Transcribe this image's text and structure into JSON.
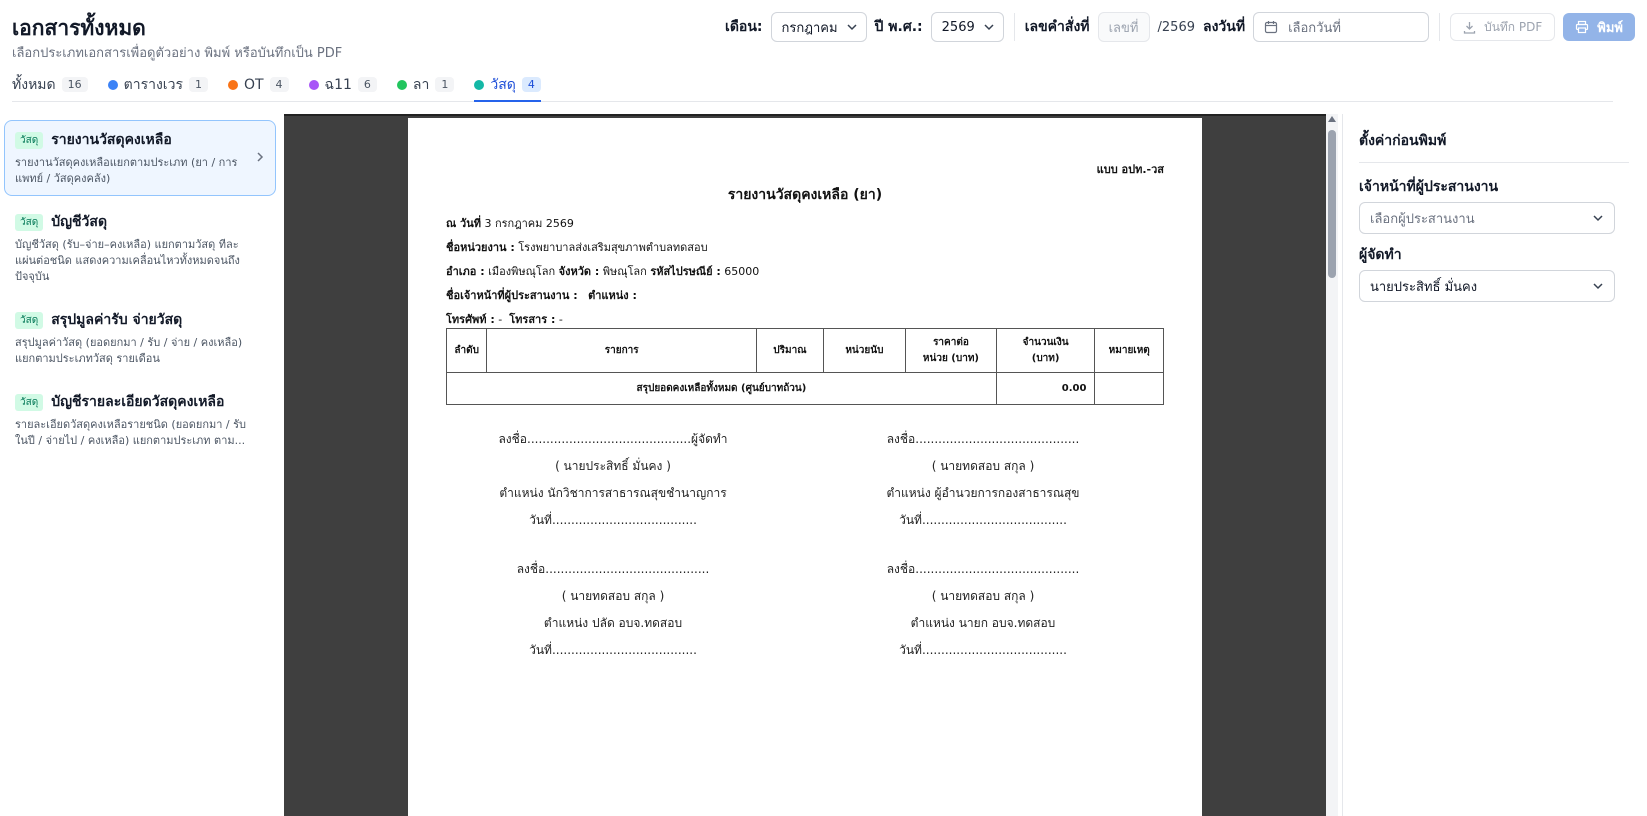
{
  "header": {
    "title": "เอกสารทั้งหมด",
    "subtitle": "เลือกประเภทเอกสารเพื่อดูตัวอย่าง พิมพ์ หรือบันทึกเป็น PDF"
  },
  "toolbar": {
    "month_label": "เดือน:",
    "month_value": "กรกฎาคม",
    "year_label": "ปี พ.ศ.:",
    "year_value": "2569",
    "order_label": "เลขคำสั่งที่",
    "order_placeholder": "เลขที่",
    "order_suffix": "/2569",
    "date_label": "ลงวันที่",
    "date_placeholder": "เลือกวันที่",
    "save_pdf_label": "บันทึก PDF",
    "print_label": "พิมพ์"
  },
  "tabs": [
    {
      "label": "ทั้งหมด",
      "count": "16",
      "color": ""
    },
    {
      "label": "ตารางเวร",
      "count": "1",
      "color": "#3b82f6"
    },
    {
      "label": "OT",
      "count": "4",
      "color": "#f97316"
    },
    {
      "label": "ฉ11",
      "count": "6",
      "color": "#a855f7"
    },
    {
      "label": "ลา",
      "count": "1",
      "color": "#22c55e"
    },
    {
      "label": "วัสดุ",
      "count": "4",
      "color": "#14b8a6"
    }
  ],
  "documents": [
    {
      "tag": "วัสดุ",
      "title": "รายงานวัสดุคงเหลือ",
      "desc": "รายงานวัสดุคงเหลือแยกตามประเภท (ยา / การแพทย์ / วัสดุคงคลัง)"
    },
    {
      "tag": "วัสดุ",
      "title": "บัญชีวัสดุ",
      "desc": "บัญชีวัสดุ (รับ–จ่าย–คงเหลือ) แยกตามวัสดุ ทีละแผ่นต่อชนิด แสดงความเคลื่อนไหวทั้งหมดจนถึงปัจจุบัน"
    },
    {
      "tag": "วัสดุ",
      "title": "สรุปมูลค่ารับ จ่ายวัสดุ",
      "desc": "สรุปมูลค่าวัสดุ (ยอดยกมา / รับ / จ่าย / คงเหลือ) แยกตามประเภทวัสดุ รายเดือน"
    },
    {
      "tag": "วัสดุ",
      "title": "บัญชีรายละเอียดวัสดุคงเหลือ",
      "desc": "รายละเอียดวัสดุคงเหลือรายชนิด (ยอดยกมา / รับในปี / จ่ายไป / คงเหลือ) แยกตามประเภท ตาม..."
    }
  ],
  "report": {
    "form_code": "แบบ อปท.-วส",
    "title": "รายงานวัสดุคงเหลือ (ยา)",
    "date_label": "ณ วันที่",
    "date_value": "3 กรกฎาคม 2569",
    "unit_label": "ชื่อหน่วยงาน :",
    "unit_value": "โรงพยาบาลส่งเสริมสุขภาพตำบลทดสอบ",
    "district_label": "อำเภอ :",
    "district_value": "เมืองพิษณุโลก",
    "province_label": "จังหวัด :",
    "province_value": "พิษณุโลก",
    "postcode_label": "รหัสไปรษณีย์ :",
    "postcode_value": "65000",
    "coordinator_label": "ชื่อเจ้าหน้าที่ผู้ประสานงาน :",
    "position_label": "ตำแหน่ง :",
    "phone_label": "โทรศัพท์ :",
    "phone_value": "-",
    "fax_label": "โทรสาร :",
    "fax_value": "-",
    "columns": [
      "ลำดับ",
      "รายการ",
      "ปริมาณ",
      "หน่วยนับ",
      "ราคาต่อ\nหน่วย (บาท)",
      "จำนวนเงิน\n(บาท)",
      "หมายเหตุ"
    ],
    "total_label": "สรุปยอดคงเหลือทั้งหมด (ศูนย์บาทถ้วน)",
    "total_value": "0.00",
    "signatures": [
      {
        "sign": "ลงชื่อ...........................................ผู้จัดทำ",
        "name": "( นายประสิทธิ์ มั่นคง )",
        "position": "ตำแหน่ง นักวิชาการสาธารณสุขชำนาญการ",
        "date": "วันที่......................................"
      },
      {
        "sign": "ลงชื่อ...........................................",
        "name": "( นายทดสอบ สกุล )",
        "position": "ตำแหน่ง ผู้อำนวยการกองสาธารณสุข",
        "date": "วันที่......................................"
      },
      {
        "sign": "ลงชื่อ...........................................",
        "name": "( นายทดสอบ สกุล )",
        "position": "ตำแหน่ง ปลัด อบจ.ทดสอบ",
        "date": "วันที่......................................"
      },
      {
        "sign": "ลงชื่อ...........................................",
        "name": "( นายทดสอบ สกุล )",
        "position": "ตำแหน่ง นายก อบจ.ทดสอบ",
        "date": "วันที่......................................"
      }
    ]
  },
  "settings": {
    "title": "ตั้งค่าก่อนพิมพ์",
    "coordinator_label": "เจ้าหน้าที่ผู้ประสานงาน",
    "coordinator_placeholder": "เลือกผู้ประสานงาน",
    "preparer_label": "ผู้จัดทำ",
    "preparer_value": "นายประสิทธิ์ มั่นคง"
  },
  "colors": {
    "accent": "#2563eb",
    "print_button": "#93b4e8",
    "tag_bg": "#d1fae5"
  }
}
